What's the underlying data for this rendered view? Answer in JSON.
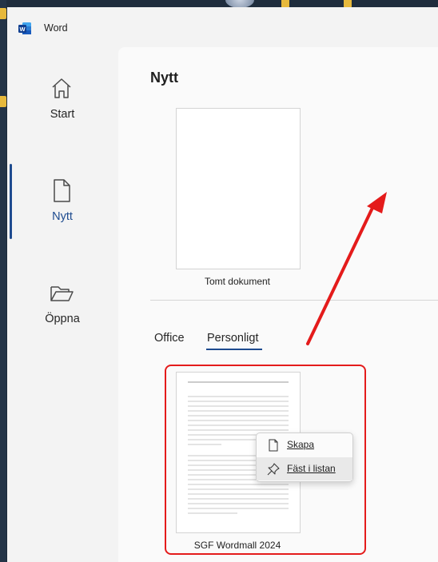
{
  "app": {
    "title": "Word"
  },
  "nav": [
    {
      "label": "Start",
      "icon": "home-icon"
    },
    {
      "label": "Nytt",
      "icon": "new-document-icon",
      "active": true
    },
    {
      "label": "Öppna",
      "icon": "folder-open-icon"
    }
  ],
  "main": {
    "title": "Nytt",
    "blank": {
      "label": "Tomt dokument"
    },
    "tabs": [
      {
        "label": "Office",
        "selected": false
      },
      {
        "label": "Personligt",
        "selected": true
      }
    ],
    "template": {
      "label": "SGF Wordmall 2024"
    }
  },
  "context_menu": {
    "items": [
      {
        "label": "Skapa",
        "icon": "document-icon"
      },
      {
        "label": "Fäst i listan",
        "icon": "pin-icon",
        "hover": true
      }
    ]
  },
  "colors": {
    "accent": "#1e4b8f",
    "annotation": "#e41b1b",
    "word_brand": "#185abd"
  }
}
